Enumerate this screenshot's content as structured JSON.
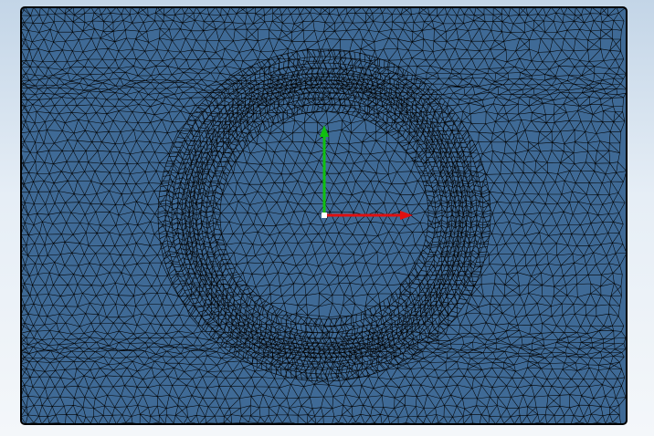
{
  "viewport": {
    "background_top": "#c3d5e7",
    "background_bottom": "#f4f7fa"
  },
  "mesh": {
    "shape": "rectangular plate with circular hole",
    "element_type": "triangle",
    "face_color": "#3f6a96",
    "edge_color": "#000000",
    "refined_ring": true
  },
  "triad": {
    "x_axis_color": "#e01010",
    "y_axis_color": "#10c010",
    "origin_color": "#ffffff"
  }
}
